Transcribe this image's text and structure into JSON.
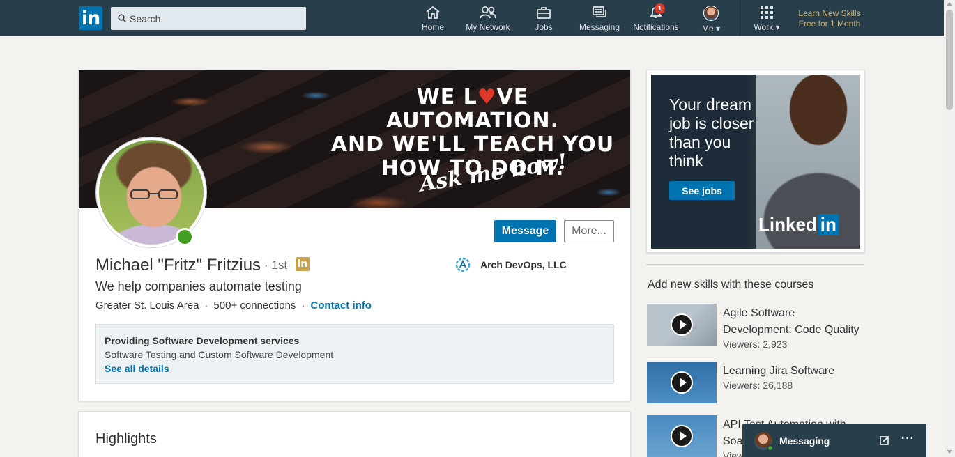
{
  "nav": {
    "logo": "in",
    "search_placeholder": "Search",
    "items": [
      {
        "label": "Home",
        "icon": "home-icon"
      },
      {
        "label": "My Network",
        "icon": "network-icon"
      },
      {
        "label": "Jobs",
        "icon": "briefcase-icon"
      },
      {
        "label": "Messaging",
        "icon": "messaging-icon"
      },
      {
        "label": "Notifications",
        "icon": "bell-icon",
        "badge": "1"
      },
      {
        "label": "Me",
        "icon": "avatar"
      },
      {
        "label": "Work",
        "icon": "grid-icon"
      }
    ],
    "promo_line1": "Learn New Skills",
    "promo_line2": "Free for 1 Month"
  },
  "profile": {
    "banner": {
      "line1": "WE L",
      "line1b": "VE AUTOMATION.",
      "line2": "AND WE'LL TEACH YOU",
      "line3": "HOW TO DO IT.",
      "script": "Ask me how!"
    },
    "message_label": "Message",
    "more_label": "More...",
    "name": "Michael \"Fritz\" Fritzius",
    "degree": "· 1st",
    "degree_badge": "in",
    "company": "Arch DevOps, LLC",
    "headline": "We help companies automate testing",
    "location": "Greater St. Louis Area",
    "separator": "·",
    "connections": "500+ connections",
    "contact_info": "Contact info",
    "services": {
      "title": "Providing Software Development services",
      "description": "Software Testing and Custom Software Development",
      "link": "See all details"
    }
  },
  "highlights": {
    "title": "Highlights"
  },
  "ad": {
    "headline": "Your dream job is closer than you think",
    "button": "See jobs",
    "brand": "Linked",
    "brand_in": "in"
  },
  "courses": {
    "title": "Add new skills with these courses",
    "items": [
      {
        "title": "Agile Software Development: Code Quality",
        "viewers": "Viewers: 2,923"
      },
      {
        "title": "Learning Jira Software",
        "viewers": "Viewers: 26,188"
      },
      {
        "title": "API Test Automation with SoapUI",
        "viewers": "Viewers"
      }
    ]
  },
  "messaging": {
    "label": "Messaging",
    "more": "···"
  },
  "colors": {
    "nav": "#283e4a",
    "accent": "#0073b1",
    "online": "#459e24",
    "badge": "#e0372b",
    "promo": "#c9b67e"
  }
}
